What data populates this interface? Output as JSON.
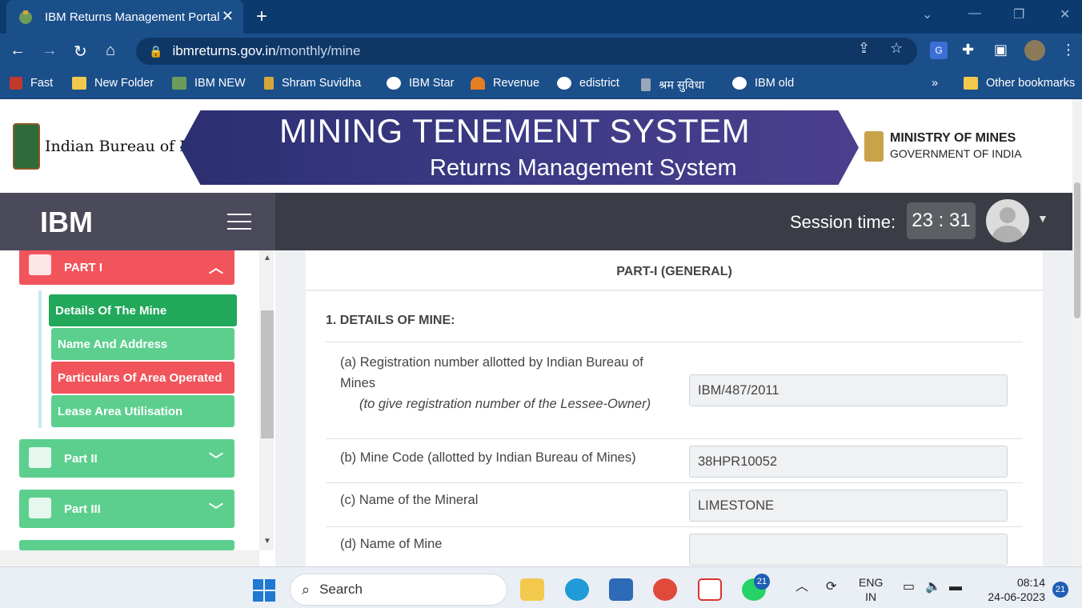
{
  "browser": {
    "tab_title": "IBM Returns Management Portal",
    "tab_close": "✕",
    "new_tab": "+",
    "url_domain": "ibmreturns.gov.in",
    "url_path": "/monthly/mine",
    "bookmarks": [
      "Fast",
      "New Folder",
      "IBM NEW",
      "Shram Suvidha",
      "IBM Star",
      "Revenue",
      "edistrict",
      "श्रम सुविधा",
      "IBM old"
    ],
    "bookmarks_more": "»",
    "other_bookmarks": "Other bookmarks"
  },
  "header": {
    "ibm_logo_text": "Indian Bureau of Mines",
    "banner_title": "MINING TENEMENT SYSTEM",
    "banner_subtitle": "Returns Management System",
    "ministry_line1": "MINISTRY OF MINES",
    "ministry_line2": "GOVERNMENT OF INDIA"
  },
  "appbar": {
    "brand": "IBM",
    "session_label": "Session time:",
    "session_time": "23 : 31"
  },
  "sidebar": {
    "part1": "PART I",
    "sub_items": [
      "Details Of The Mine",
      "Name And Address",
      "Particulars Of Area Operated",
      "Lease Area Utilisation"
    ],
    "part2": "Part II",
    "part3": "Part III"
  },
  "main": {
    "card_title": "PART-I (GENERAL)",
    "section_title": "1. DETAILS OF MINE:",
    "rows": [
      {
        "label": "(a) Registration number allotted by Indian Bureau of Mines",
        "note": "(to give registration number of the Lessee-Owner)",
        "value": "IBM/487/2011"
      },
      {
        "label": "(b) Mine Code (allotted by Indian Bureau of Mines)",
        "value": "38HPR10052"
      },
      {
        "label": "(c) Name of the Mineral",
        "value": "LIMESTONE"
      },
      {
        "label": "(d) Name of Mine",
        "value": ""
      }
    ]
  },
  "taskbar": {
    "search": "Search",
    "whatsapp_badge": "21",
    "lang1": "ENG",
    "lang2": "IN",
    "time": "08:14",
    "date": "24-06-2023",
    "notif_badge": "21"
  },
  "colors": {
    "part_red": "#f2545b",
    "green": "#5ccf8e",
    "green_active": "#22a85a"
  }
}
